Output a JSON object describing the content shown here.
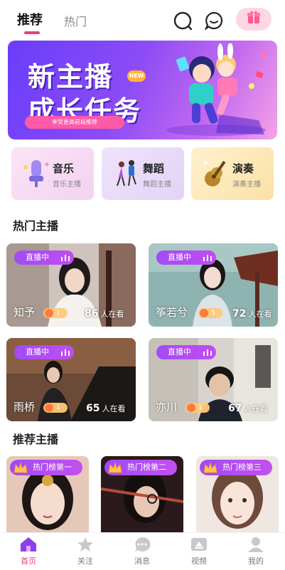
{
  "top_tabs": [
    {
      "label": "推荐",
      "active": true
    },
    {
      "label": "热门",
      "active": false
    }
  ],
  "colors": {
    "accent": "#e8407a",
    "badge_purple": "#a24cf5",
    "banner_start": "#6a3dfb",
    "banner_end": "#f4a3e6"
  },
  "icons": {
    "search": "search-icon",
    "chat": "chat-bubble-icon",
    "gift": "gift-box-icon"
  },
  "banner": {
    "title_line1": "新主播",
    "title_line2": "成长任务",
    "new_tag": "NEW",
    "pill_text": "享受更高前段推荐"
  },
  "categories": [
    {
      "name": "音乐",
      "sub": "音乐主播",
      "icon": "microphone-icon"
    },
    {
      "name": "舞蹈",
      "sub": "舞蹈主播",
      "icon": "dancers-icon"
    },
    {
      "name": "演奏",
      "sub": "演奏主播",
      "icon": "guitar-icon"
    }
  ],
  "hot_section": {
    "title": "热门主播"
  },
  "hot_streamers": [
    {
      "live_label": "直播中",
      "name": "知予",
      "level": "1",
      "viewers": "86",
      "viewers_unit": "人在看"
    },
    {
      "live_label": "直播中",
      "name": "筝若兮",
      "level": "5",
      "viewers": "72",
      "viewers_unit": "人在看"
    },
    {
      "live_label": "直播中",
      "name": "雨桥",
      "level": "1",
      "viewers": "65",
      "viewers_unit": "人在看"
    },
    {
      "live_label": "直播中",
      "name": "亦川",
      "level": "1",
      "viewers": "67",
      "viewers_unit": "人在看"
    }
  ],
  "recommend_section": {
    "title": "推荐主播"
  },
  "recommend_streamers": [
    {
      "badge": "热门榜第一"
    },
    {
      "badge": "热门榜第二"
    },
    {
      "badge": "热门榜第三"
    }
  ],
  "bottom_nav": [
    {
      "label": "首页",
      "icon": "home-icon",
      "active": true
    },
    {
      "label": "关注",
      "icon": "star-icon",
      "active": false
    },
    {
      "label": "消息",
      "icon": "message-icon",
      "active": false
    },
    {
      "label": "视频",
      "icon": "video-icon",
      "active": false
    },
    {
      "label": "我的",
      "icon": "profile-icon",
      "active": false
    }
  ]
}
